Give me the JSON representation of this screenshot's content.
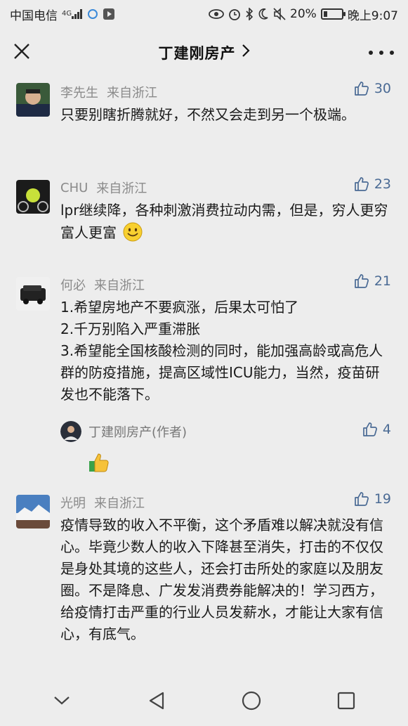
{
  "status_bar": {
    "carrier": "中国电信",
    "network": "4G",
    "battery": "20%",
    "battery_level": 0.2,
    "time": "晚上9:07"
  },
  "header": {
    "title": "丁建刚房产",
    "close_icon": "close-icon",
    "more_icon": "more-icon"
  },
  "comments": [
    {
      "name": "李先生",
      "location": "来自浙江",
      "likes": "30",
      "text": "只要别瞎折腾就好，不然又会走到另一个极端。"
    },
    {
      "name": "CHU",
      "location": "来自浙江",
      "likes": "23",
      "text": "lpr继续降，各种刺激消费拉动内需，但是，穷人更穷富人更富",
      "emoji": "smile-emoji"
    },
    {
      "name": "何必",
      "location": "来自浙江",
      "likes": "21",
      "lines": [
        "1.希望房地产不要疯涨，后果太可怕了",
        "2.千万别陷入严重滞胀",
        "3.希望能全国核酸检测的同时，能加强高龄或高危人群的防疫措施，提高区域性ICU能力，当然，疫苗研发也不能落下。"
      ],
      "reply": {
        "name": "丁建刚房产(作者)",
        "likes": "4",
        "emoji": "thumbs-up-emoji"
      }
    },
    {
      "name": "光明",
      "location": "来自浙江",
      "likes": "19",
      "text": "疫情导致的收入不平衡，这个矛盾难以解决就没有信心。毕竟少数人的收入下降甚至消失，打击的不仅仅是身处其境的这些人，还会打击所处的家庭以及朋友圈。不是降息、广发发消费券能解决的！学习西方，给疫情打击严重的行业人员发薪水，才能让大家有信心，有底气。"
    }
  ],
  "colors": {
    "background": "#ededed",
    "like_blue": "#4a6a94",
    "meta_gray": "#8a8a8a"
  }
}
